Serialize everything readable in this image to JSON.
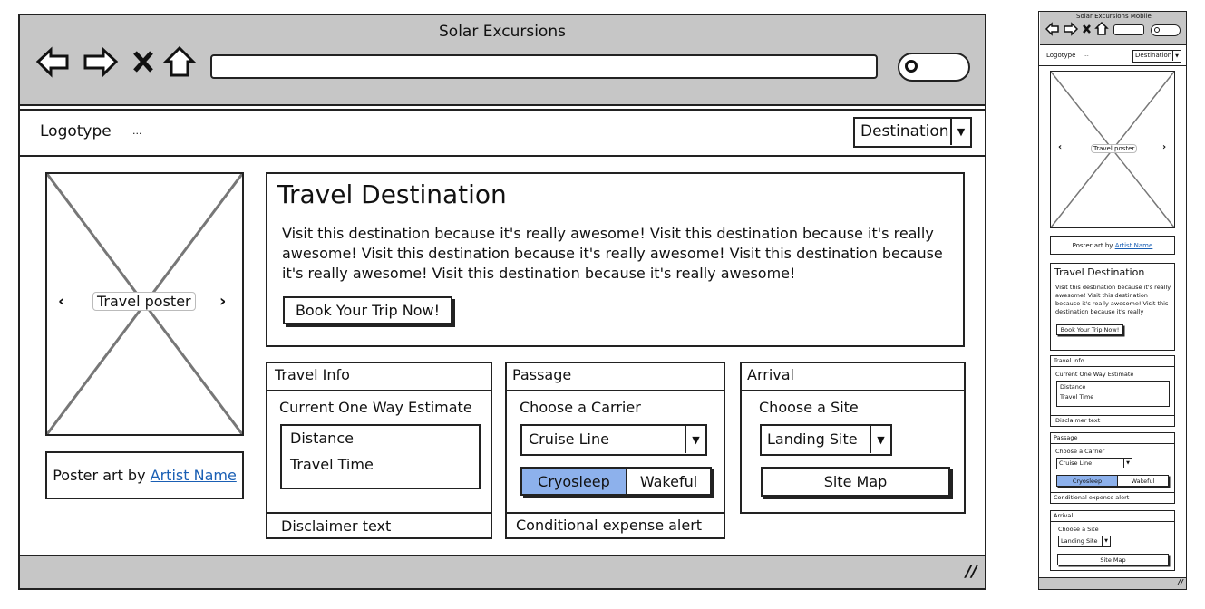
{
  "desktop": {
    "window_title": "Solar Excursions",
    "nav": {
      "logotype": "Logotype",
      "ellipsis": "...",
      "dropdown": "Destination"
    },
    "poster": {
      "label": "Travel poster",
      "caption_prefix": "Poster art by",
      "artist_link": "Artist Name"
    },
    "destination": {
      "title": "Travel Destination",
      "lines": [
        "Visit this destination because it's really awesome! Visit this destination because it's really",
        "awesome! Visit this destination because it's really awesome! Visit this destination because",
        "it's really awesome! Visit this destination because it's really awesome!"
      ],
      "button": "Book Your Trip Now!"
    },
    "travel_info": {
      "header": "Travel Info",
      "subtitle": "Current One Way Estimate",
      "items": [
        "Distance",
        "Travel Time"
      ],
      "footer": "Disclaimer text"
    },
    "passage": {
      "header": "Passage",
      "subtitle": "Choose a Carrier",
      "dropdown": "Cruise Line",
      "toggle": [
        "Cryosleep",
        "Wakeful"
      ],
      "selected": "Cryosleep",
      "footer": "Conditional expense alert"
    },
    "arrival": {
      "header": "Arrival",
      "subtitle": "Choose a Site",
      "dropdown": "Landing Site",
      "button": "Site Map"
    }
  },
  "mobile": {
    "window_title": "Solar Excursions Mobile",
    "nav": {
      "logotype": "Logotype",
      "ellipsis": "...",
      "dropdown": "Destination"
    },
    "poster": {
      "label": "Travel poster",
      "caption_prefix": "Poster art by",
      "artist_link": "Artist Name"
    },
    "destination": {
      "title": "Travel Destination",
      "lines": [
        "Visit this destination because it's really",
        "awesome! Visit this destination",
        "because it's really awesome! Visit this",
        "destination because it's really"
      ],
      "button": "Book Your Trip Now!"
    },
    "travel_info": {
      "header": "Travel Info",
      "subtitle": "Current One Way Estimate",
      "items": [
        "Distance",
        "Travel Time"
      ],
      "footer": "Disclaimer text"
    },
    "passage": {
      "header": "Passage",
      "subtitle": "Choose a Carrier",
      "dropdown": "Cruise Line",
      "toggle": [
        "Cryosleep",
        "Wakeful"
      ],
      "footer": "Conditional expense alert"
    },
    "arrival": {
      "header": "Arrival",
      "subtitle": "Choose a Site",
      "dropdown": "Landing Site",
      "button": "Site Map"
    }
  },
  "colors": {
    "chrome": "#c6c6c6",
    "selected_toggle": "#8db1ec",
    "link": "#1a5fb4"
  }
}
